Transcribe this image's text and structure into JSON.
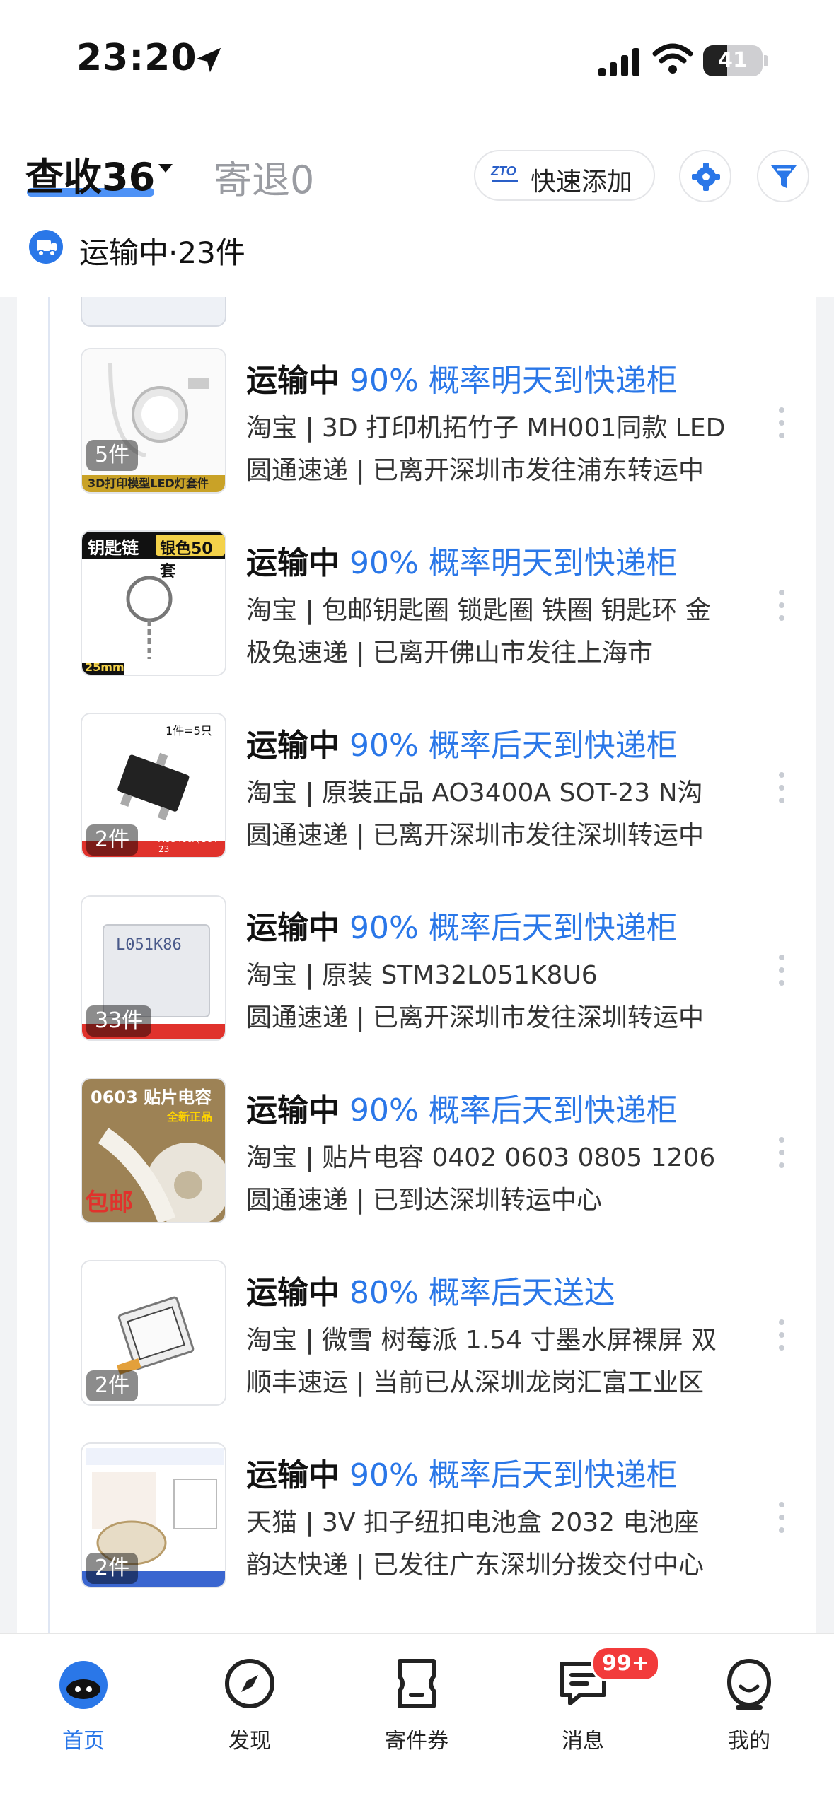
{
  "status_bar": {
    "time": "23:20",
    "battery": "41",
    "battery_level": 0.41
  },
  "header": {
    "tab_active": "查收36",
    "tab_inactive": "寄退0",
    "quick_add_label": "快速添加",
    "section_title": "运输中·23件"
  },
  "items": [
    {
      "status": "运输中",
      "probability": "90% 概率明天到快递柜",
      "desc": "淘宝 | 3D 打印机拓竹子 MH001同款 LED",
      "tracking": "圆通速递 | 已离开深圳市发往浦东转运中",
      "count": "5件",
      "thumb_caption": "3D打印模型LED灯套件"
    },
    {
      "status": "运输中",
      "probability": "90% 概率明天到快递柜",
      "desc": "淘宝 | 包邮钥匙圈 锁匙圈 铁圈 钥匙环 金",
      "tracking": "极兔速递 | 已离开佛山市发往上海市",
      "count": "",
      "thumb_caption": "钥匙链",
      "thumb_tag": "银色50套",
      "thumb_size": "25mm"
    },
    {
      "status": "运输中",
      "probability": "90% 概率后天到快递柜",
      "desc": "淘宝 | 原装正品 AO3400A SOT-23 N沟",
      "tracking": "圆通速递 | 已离开深圳市发往深圳转运中",
      "count": "2件",
      "thumb_caption": "AO3400A/SOT-23",
      "thumb_tag": "1件=5只"
    },
    {
      "status": "运输中",
      "probability": "90% 概率后天到快递柜",
      "desc": "淘宝 | 原装 STM32L051K8U6",
      "tracking": "圆通速递 | 已离开深圳市发往深圳转运中",
      "count": "33件",
      "thumb_caption": "L051K86"
    },
    {
      "status": "运输中",
      "probability": "90% 概率后天到快递柜",
      "desc": "淘宝 | 贴片电容 0402 0603 0805 1206",
      "tracking": "圆通速递 | 已到达深圳转运中心",
      "count": "",
      "thumb_caption": "0603 贴片电容",
      "thumb_tag": "全新正品",
      "thumb_size": "包邮"
    },
    {
      "status": "运输中",
      "probability": "80% 概率后天送达",
      "desc": "淘宝 | 微雪 树莓派 1.54 寸墨水屏裸屏 双",
      "tracking": "顺丰速运 | 当前已从深圳龙岗汇富工业区",
      "count": "2件"
    },
    {
      "status": "运输中",
      "probability": "90% 概率后天到快递柜",
      "desc": "天猫 | 3V 扣子纽扣电池盒 2032 电池座",
      "tracking": "韵达快递 | 已发往广东深圳分拨交付中心",
      "count": "2件"
    }
  ],
  "tabbar": {
    "home": "首页",
    "discover": "发现",
    "coupons": "寄件券",
    "messages": "消息",
    "messages_badge": "99+",
    "mine": "我的"
  },
  "colors": {
    "accent": "#2a77e8",
    "badge": "#f23b3b"
  }
}
